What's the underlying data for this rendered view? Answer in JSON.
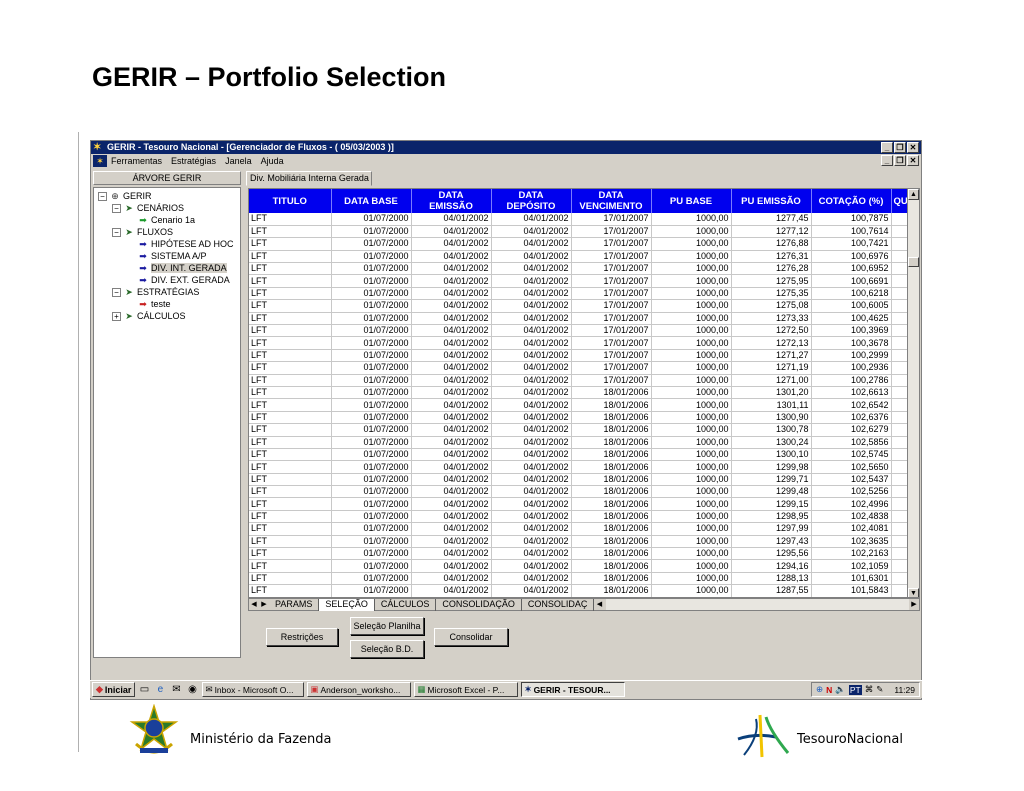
{
  "slide": {
    "title": "GERIR – Portfolio Selection",
    "footer_left": "Ministério da Fazenda",
    "footer_right": "TesouroNacional"
  },
  "window": {
    "title": "GERIR - Tesouro Nacional - [Gerenciador de Fluxos - ( 05/03/2003 )]",
    "menu": [
      "Ferramentas",
      "Estratégias",
      "Janela",
      "Ajuda"
    ]
  },
  "left_panel": {
    "header": "ÁRVORE GERIR",
    "tree": [
      {
        "label": "GERIR",
        "level": 0,
        "icon": "globe-icon",
        "expander": "⊟"
      },
      {
        "label": "CENÁRIOS",
        "level": 1,
        "icon": "arrow-icon",
        "expander": "⊟"
      },
      {
        "label": "Cenario 1a",
        "level": 2,
        "icon": "arrow-right-green-icon"
      },
      {
        "label": "FLUXOS",
        "level": 1,
        "icon": "arrow-icon",
        "expander": "⊟"
      },
      {
        "label": "HIPÓTESE AD HOC",
        "level": 2,
        "icon": "arrow-right-blue-icon"
      },
      {
        "label": "SISTEMA A/P",
        "level": 2,
        "icon": "arrow-right-blue-icon"
      },
      {
        "label": "DIV. INT. GERADA",
        "level": 2,
        "icon": "arrow-right-blue-icon",
        "selected": true
      },
      {
        "label": "DIV. EXT. GERADA",
        "level": 2,
        "icon": "arrow-right-blue-icon"
      },
      {
        "label": "ESTRATÉGIAS",
        "level": 1,
        "icon": "arrow-icon",
        "expander": "⊟"
      },
      {
        "label": "teste",
        "level": 2,
        "icon": "arrow-right-red-icon"
      },
      {
        "label": "CÁLCULOS",
        "level": 1,
        "icon": "arrow-icon",
        "expander": "⊞"
      }
    ]
  },
  "doc_tab": "Div. Mobiliária Interna Gerada",
  "grid": {
    "columns": [
      "TITULO",
      "DATA BASE",
      "DATA\nEMISSÃO",
      "DATA\nDEPÓSITO",
      "DATA\nVENCIMENTO",
      "PU BASE",
      "PU EMISSÃO",
      "COTAÇÃO (%)",
      "QU"
    ],
    "rows": [
      [
        "LFT",
        "01/07/2000",
        "04/01/2002",
        "04/01/2002",
        "17/01/2007",
        "1000,00",
        "1277,45",
        "100,7875"
      ],
      [
        "LFT",
        "01/07/2000",
        "04/01/2002",
        "04/01/2002",
        "17/01/2007",
        "1000,00",
        "1277,12",
        "100,7614"
      ],
      [
        "LFT",
        "01/07/2000",
        "04/01/2002",
        "04/01/2002",
        "17/01/2007",
        "1000,00",
        "1276,88",
        "100,7421"
      ],
      [
        "LFT",
        "01/07/2000",
        "04/01/2002",
        "04/01/2002",
        "17/01/2007",
        "1000,00",
        "1276,31",
        "100,6976"
      ],
      [
        "LFT",
        "01/07/2000",
        "04/01/2002",
        "04/01/2002",
        "17/01/2007",
        "1000,00",
        "1276,28",
        "100,6952"
      ],
      [
        "LFT",
        "01/07/2000",
        "04/01/2002",
        "04/01/2002",
        "17/01/2007",
        "1000,00",
        "1275,95",
        "100,6691"
      ],
      [
        "LFT",
        "01/07/2000",
        "04/01/2002",
        "04/01/2002",
        "17/01/2007",
        "1000,00",
        "1275,35",
        "100,6218"
      ],
      [
        "LFT",
        "01/07/2000",
        "04/01/2002",
        "04/01/2002",
        "17/01/2007",
        "1000,00",
        "1275,08",
        "100,6005"
      ],
      [
        "LFT",
        "01/07/2000",
        "04/01/2002",
        "04/01/2002",
        "17/01/2007",
        "1000,00",
        "1273,33",
        "100,4625"
      ],
      [
        "LFT",
        "01/07/2000",
        "04/01/2002",
        "04/01/2002",
        "17/01/2007",
        "1000,00",
        "1272,50",
        "100,3969"
      ],
      [
        "LFT",
        "01/07/2000",
        "04/01/2002",
        "04/01/2002",
        "17/01/2007",
        "1000,00",
        "1272,13",
        "100,3678"
      ],
      [
        "LFT",
        "01/07/2000",
        "04/01/2002",
        "04/01/2002",
        "17/01/2007",
        "1000,00",
        "1271,27",
        "100,2999"
      ],
      [
        "LFT",
        "01/07/2000",
        "04/01/2002",
        "04/01/2002",
        "17/01/2007",
        "1000,00",
        "1271,19",
        "100,2936"
      ],
      [
        "LFT",
        "01/07/2000",
        "04/01/2002",
        "04/01/2002",
        "17/01/2007",
        "1000,00",
        "1271,00",
        "100,2786"
      ],
      [
        "LFT",
        "01/07/2000",
        "04/01/2002",
        "04/01/2002",
        "18/01/2006",
        "1000,00",
        "1301,20",
        "102,6613"
      ],
      [
        "LFT",
        "01/07/2000",
        "04/01/2002",
        "04/01/2002",
        "18/01/2006",
        "1000,00",
        "1301,11",
        "102,6542"
      ],
      [
        "LFT",
        "01/07/2000",
        "04/01/2002",
        "04/01/2002",
        "18/01/2006",
        "1000,00",
        "1300,90",
        "102,6376"
      ],
      [
        "LFT",
        "01/07/2000",
        "04/01/2002",
        "04/01/2002",
        "18/01/2006",
        "1000,00",
        "1300,78",
        "102,6279"
      ],
      [
        "LFT",
        "01/07/2000",
        "04/01/2002",
        "04/01/2002",
        "18/01/2006",
        "1000,00",
        "1300,24",
        "102,5856"
      ],
      [
        "LFT",
        "01/07/2000",
        "04/01/2002",
        "04/01/2002",
        "18/01/2006",
        "1000,00",
        "1300,10",
        "102,5745"
      ],
      [
        "LFT",
        "01/07/2000",
        "04/01/2002",
        "04/01/2002",
        "18/01/2006",
        "1000,00",
        "1299,98",
        "102,5650"
      ],
      [
        "LFT",
        "01/07/2000",
        "04/01/2002",
        "04/01/2002",
        "18/01/2006",
        "1000,00",
        "1299,71",
        "102,5437"
      ],
      [
        "LFT",
        "01/07/2000",
        "04/01/2002",
        "04/01/2002",
        "18/01/2006",
        "1000,00",
        "1299,48",
        "102,5256"
      ],
      [
        "LFT",
        "01/07/2000",
        "04/01/2002",
        "04/01/2002",
        "18/01/2006",
        "1000,00",
        "1299,15",
        "102,4996"
      ],
      [
        "LFT",
        "01/07/2000",
        "04/01/2002",
        "04/01/2002",
        "18/01/2006",
        "1000,00",
        "1298,95",
        "102,4838"
      ],
      [
        "LFT",
        "01/07/2000",
        "04/01/2002",
        "04/01/2002",
        "18/01/2006",
        "1000,00",
        "1297,99",
        "102,4081"
      ],
      [
        "LFT",
        "01/07/2000",
        "04/01/2002",
        "04/01/2002",
        "18/01/2006",
        "1000,00",
        "1297,43",
        "102,3635"
      ],
      [
        "LFT",
        "01/07/2000",
        "04/01/2002",
        "04/01/2002",
        "18/01/2006",
        "1000,00",
        "1295,56",
        "102,2163"
      ],
      [
        "LFT",
        "01/07/2000",
        "04/01/2002",
        "04/01/2002",
        "18/01/2006",
        "1000,00",
        "1294,16",
        "102,1059"
      ],
      [
        "LFT",
        "01/07/2000",
        "04/01/2002",
        "04/01/2002",
        "18/01/2006",
        "1000,00",
        "1288,13",
        "101,6301"
      ],
      [
        "LFT",
        "01/07/2000",
        "04/01/2002",
        "04/01/2002",
        "18/01/2006",
        "1000,00",
        "1287,55",
        "101,5843"
      ]
    ]
  },
  "sheet_tabs": [
    "PARAMS",
    "SELEÇÃO",
    "CÁLCULOS",
    "CONSOLIDAÇÃO",
    "CONSOLIDAÇ"
  ],
  "active_sheet_tab": "SELEÇÃO",
  "buttons": {
    "restricoes": "Restrições",
    "selecao_planilha": "Seleção Planilha",
    "selecao_bd": "Seleção B.D.",
    "consolidar": "Consolidar"
  },
  "taskbar": {
    "start": "Iniciar",
    "tasks": [
      "Inbox - Microsoft O...",
      "Anderson_worksho...",
      "Microsoft Excel - P...",
      "GERIR - TESOUR..."
    ],
    "active_task": "GERIR - TESOUR...",
    "tray_lang": "PT",
    "clock": "11:29"
  },
  "colors": {
    "grid_header": "#0000ee",
    "titlebar": "#0a246a",
    "window_face": "#d4d0c8"
  }
}
